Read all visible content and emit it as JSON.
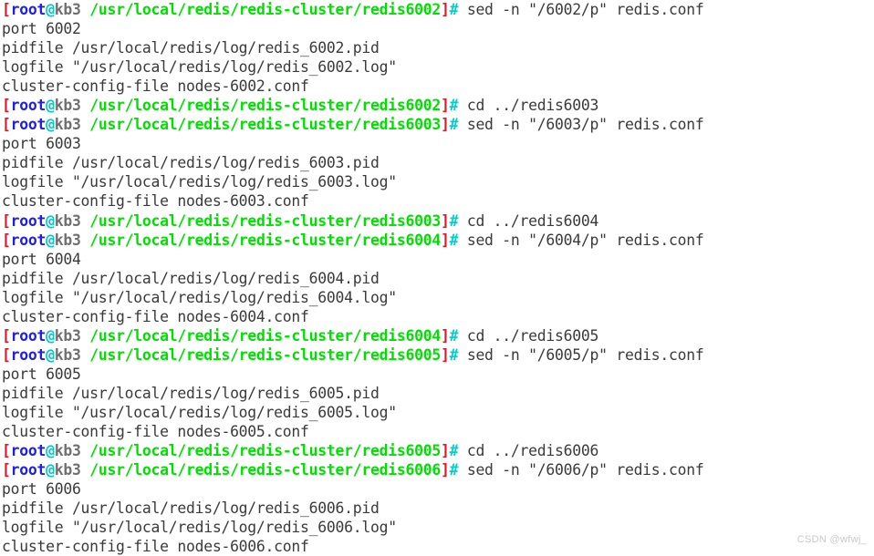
{
  "terminal": {
    "window_background": "#ffffff",
    "foreground": "#3a3a3a",
    "colors": {
      "bracket_red": "#e5152b",
      "user_blue": "#2020e0",
      "at_cyan": "#00c8c8",
      "host_gray": "#6f6f6f",
      "path_green": "#00e000",
      "hash_cyan": "#00cfcf"
    },
    "prompt": {
      "open_bracket": "[",
      "user": "root",
      "at": "@",
      "host": "kb3",
      "space": " ",
      "close_bracket": "]",
      "hash": "#",
      "path_base": "/usr/local/redis/redis-cluster/"
    },
    "lines": [
      {
        "type": "prompt",
        "path": "/usr/local/redis/redis-cluster/redis6002",
        "command": " sed -n \"/6002/p\" redis.conf"
      },
      {
        "type": "output",
        "text": "port 6002"
      },
      {
        "type": "output",
        "text": "pidfile /usr/local/redis/log/redis_6002.pid"
      },
      {
        "type": "output",
        "text": "logfile \"/usr/local/redis/log/redis_6002.log\""
      },
      {
        "type": "output",
        "text": "cluster-config-file nodes-6002.conf"
      },
      {
        "type": "prompt",
        "path": "/usr/local/redis/redis-cluster/redis6002",
        "command": " cd ../redis6003"
      },
      {
        "type": "prompt",
        "path": "/usr/local/redis/redis-cluster/redis6003",
        "command": " sed -n \"/6003/p\" redis.conf"
      },
      {
        "type": "output",
        "text": "port 6003"
      },
      {
        "type": "output",
        "text": "pidfile /usr/local/redis/log/redis_6003.pid"
      },
      {
        "type": "output",
        "text": "logfile \"/usr/local/redis/log/redis_6003.log\""
      },
      {
        "type": "output",
        "text": "cluster-config-file nodes-6003.conf"
      },
      {
        "type": "prompt",
        "path": "/usr/local/redis/redis-cluster/redis6003",
        "command": " cd ../redis6004"
      },
      {
        "type": "prompt",
        "path": "/usr/local/redis/redis-cluster/redis6004",
        "command": " sed -n \"/6004/p\" redis.conf"
      },
      {
        "type": "output",
        "text": "port 6004"
      },
      {
        "type": "output",
        "text": "pidfile /usr/local/redis/log/redis_6004.pid"
      },
      {
        "type": "output",
        "text": "logfile \"/usr/local/redis/log/redis_6004.log\""
      },
      {
        "type": "output",
        "text": "cluster-config-file nodes-6004.conf"
      },
      {
        "type": "prompt",
        "path": "/usr/local/redis/redis-cluster/redis6004",
        "command": " cd ../redis6005"
      },
      {
        "type": "prompt",
        "path": "/usr/local/redis/redis-cluster/redis6005",
        "command": " sed -n \"/6005/p\" redis.conf"
      },
      {
        "type": "output",
        "text": "port 6005"
      },
      {
        "type": "output",
        "text": "pidfile /usr/local/redis/log/redis_6005.pid"
      },
      {
        "type": "output",
        "text": "logfile \"/usr/local/redis/log/redis_6005.log\""
      },
      {
        "type": "output",
        "text": "cluster-config-file nodes-6005.conf"
      },
      {
        "type": "prompt",
        "path": "/usr/local/redis/redis-cluster/redis6005",
        "command": " cd ../redis6006"
      },
      {
        "type": "prompt",
        "path": "/usr/local/redis/redis-cluster/redis6006",
        "command": " sed -n \"/6006/p\" redis.conf"
      },
      {
        "type": "output",
        "text": "port 6006"
      },
      {
        "type": "output",
        "text": "pidfile /usr/local/redis/log/redis_6006.pid"
      },
      {
        "type": "output",
        "text": "logfile \"/usr/local/redis/log/redis_6006.log\""
      },
      {
        "type": "output",
        "text": "cluster-config-file nodes-6006.conf"
      }
    ]
  },
  "watermark": {
    "text": "CSDN @wfwj_"
  }
}
